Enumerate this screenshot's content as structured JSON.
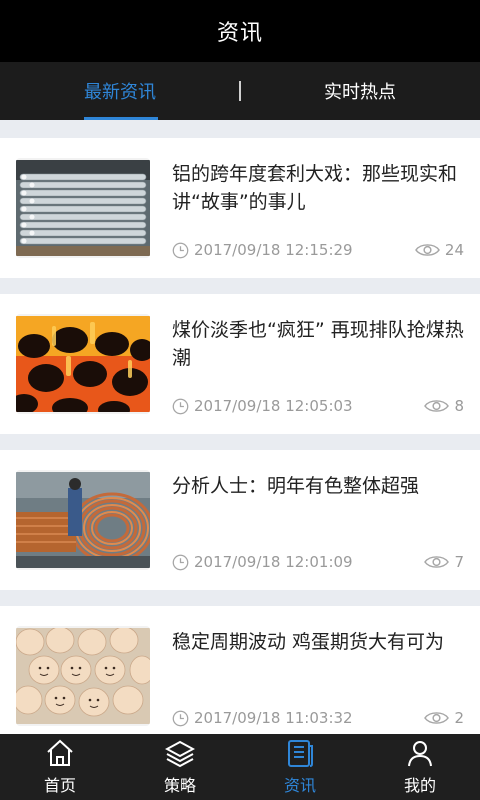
{
  "header": {
    "title": "资讯"
  },
  "tabs": [
    {
      "label": "最新资讯",
      "active": true
    },
    {
      "label": "实时热点",
      "active": false
    }
  ],
  "articles": [
    {
      "title": "铝的跨年度套利大戏：那些现实和讲“故事”的事儿",
      "time": "2017/09/18 12:15:29",
      "views": "24",
      "image": "aluminum-bars"
    },
    {
      "title": "煤价淡季也“疯狂” 再现排队抢煤热潮",
      "time": "2017/09/18 12:05:03",
      "views": "8",
      "image": "burning-coal"
    },
    {
      "title": "分析人士：明年有色整体超强",
      "time": "2017/09/18 12:01:09",
      "views": "7",
      "image": "copper-coils"
    },
    {
      "title": "稳定周期波动 鸡蛋期货大有可为",
      "time": "2017/09/18 11:03:32",
      "views": "2",
      "image": "eggs"
    }
  ],
  "tabbar": [
    {
      "label": "首页",
      "icon": "home-icon",
      "active": false
    },
    {
      "label": "策略",
      "icon": "layers-icon",
      "active": false
    },
    {
      "label": "资讯",
      "icon": "news-icon",
      "active": true
    },
    {
      "label": "我的",
      "icon": "user-icon",
      "active": false
    }
  ],
  "colors": {
    "accent": "#2f86d8",
    "header_bg": "#000000",
    "tabs_bg": "#1c1c1c",
    "feed_bg": "#e9ecf1",
    "meta_text": "#9a9a9a"
  }
}
